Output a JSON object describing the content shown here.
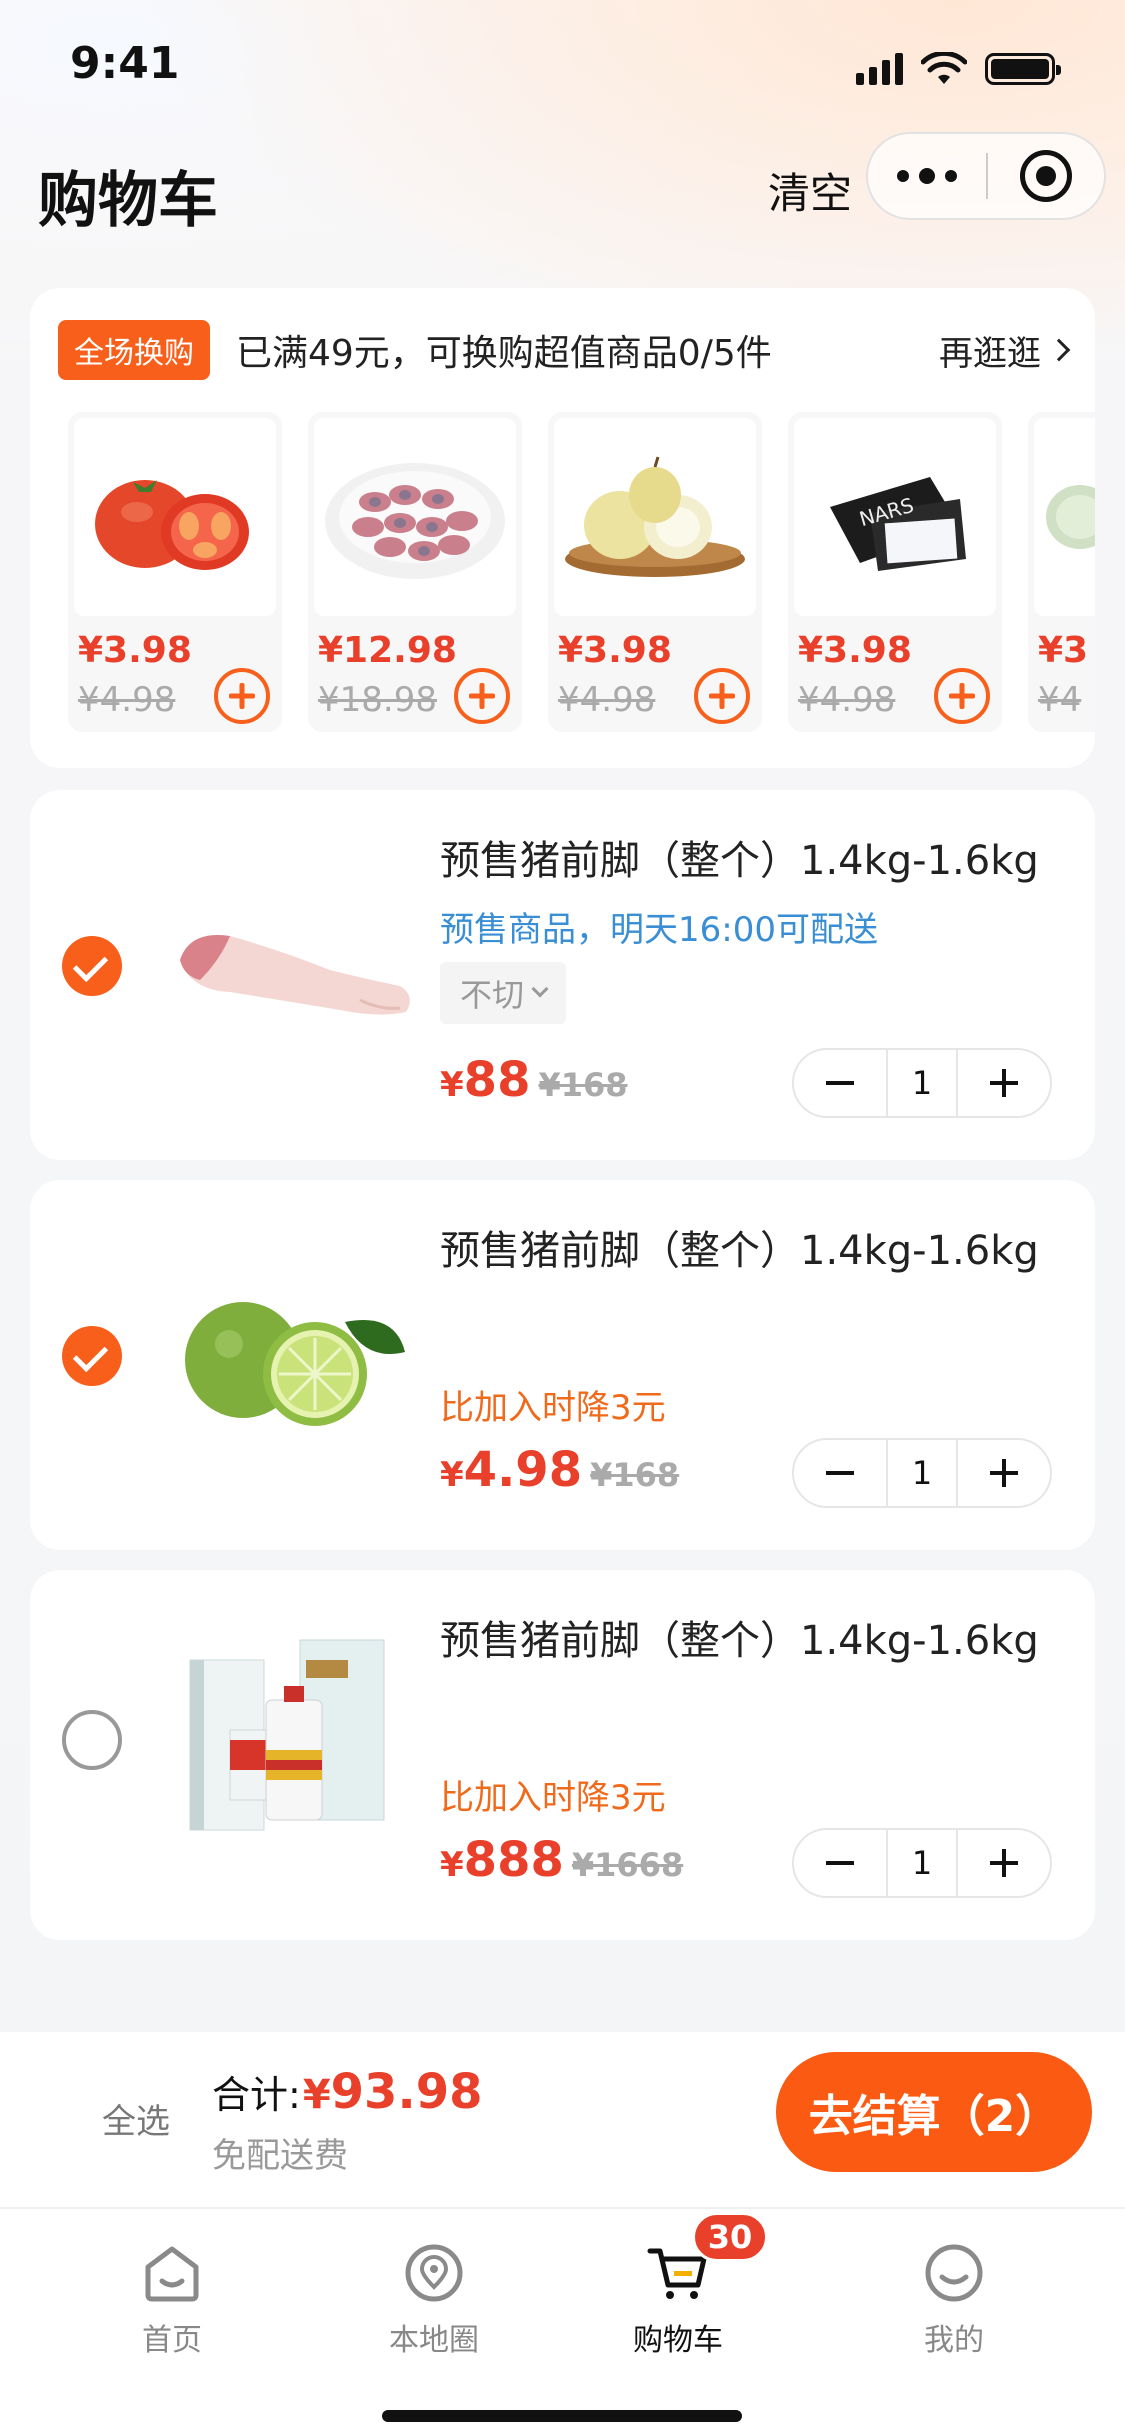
{
  "status_bar": {
    "time": "9:41"
  },
  "header": {
    "title": "购物车",
    "clear_label": "清空"
  },
  "swap": {
    "tag": "全场换购",
    "text": "已满49元，可换购超值商品0/5件",
    "more_label": "再逛逛",
    "items": [
      {
        "name": "tomato",
        "price": "¥3.98",
        "original": "¥4.98"
      },
      {
        "name": "meat-rolls",
        "price": "¥12.98",
        "original": "¥18.98"
      },
      {
        "name": "pears",
        "price": "¥3.98",
        "original": "¥4.98"
      },
      {
        "name": "nars-compact",
        "price": "¥3.98",
        "original": "¥4.98"
      },
      {
        "name": "melon",
        "price": "¥3",
        "original": "¥4"
      }
    ]
  },
  "cart": {
    "items": [
      {
        "checked": true,
        "image": "pork-trotter",
        "name": "预售猪前脚（整个）1.4kg-1.6kg",
        "note": "预售商品，明天16:00可配送",
        "spec": "不切",
        "price_yen": "¥",
        "price": "88",
        "original": "¥168",
        "qty": "1"
      },
      {
        "checked": true,
        "image": "lime",
        "name": "预售猪前脚（整个）1.4kg-1.6kg",
        "drop": "比加入时降3元",
        "price_yen": "¥",
        "price": "4.98",
        "original": "¥168",
        "qty": "1"
      },
      {
        "checked": false,
        "image": "moutai",
        "name": "预售猪前脚（整个）1.4kg-1.6kg",
        "drop": "比加入时降3元",
        "price_yen": "¥",
        "price": "888",
        "original": "¥1668",
        "qty": "1"
      }
    ]
  },
  "checkout": {
    "select_all": "全选",
    "total_label": "合计:",
    "total_yen": "¥",
    "total_value": "93.98",
    "free_shipping": "免配送费",
    "pay_label": "去结算（2）"
  },
  "tabbar": {
    "items": [
      {
        "label": "首页",
        "icon": "home-icon"
      },
      {
        "label": "本地圈",
        "icon": "location-icon"
      },
      {
        "label": "购物车",
        "icon": "cart-icon"
      },
      {
        "label": "我的",
        "icon": "profile-icon"
      }
    ],
    "cart_badge": "30"
  },
  "colors": {
    "accent": "#f85f1a",
    "price": "#e8402a",
    "note_blue": "#3a8ed3"
  }
}
